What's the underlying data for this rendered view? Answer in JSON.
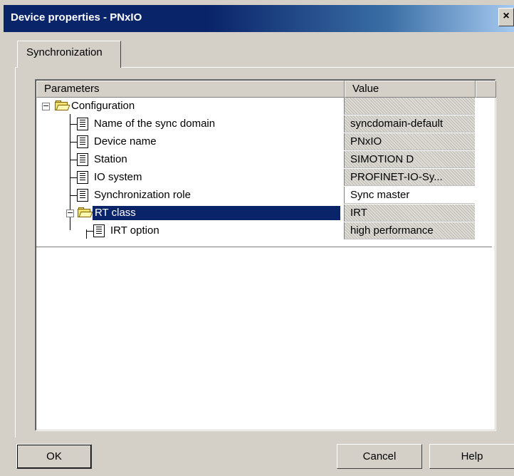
{
  "window": {
    "title": "Device properties - PNxIO",
    "close_glyph": "×"
  },
  "tabs": [
    {
      "label": "Synchronization"
    }
  ],
  "table": {
    "headers": {
      "parameters": "Parameters",
      "value": "Value"
    },
    "rows": [
      {
        "label": "Configuration",
        "value": "",
        "kind": "folder"
      },
      {
        "label": "Name of the sync domain",
        "value": "syncdomain-default",
        "kind": "doc"
      },
      {
        "label": "Device name",
        "value": "PNxIO",
        "kind": "doc"
      },
      {
        "label": "Station",
        "value": "SIMOTION D",
        "kind": "doc"
      },
      {
        "label": "IO system",
        "value": "PROFINET-IO-Sy...",
        "kind": "doc"
      },
      {
        "label": "Synchronization role",
        "value": "Sync master",
        "kind": "doc"
      },
      {
        "label": "RT class",
        "value": "IRT",
        "kind": "folder",
        "selected": true
      },
      {
        "label": "IRT option",
        "value": "high performance",
        "kind": "doc"
      }
    ]
  },
  "buttons": {
    "ok": "OK",
    "cancel": "Cancel",
    "help": "Help"
  },
  "icons": {
    "expander_collapse": "−",
    "expander_expand": "−"
  },
  "colors": {
    "title_bar": "#0a246a",
    "selection": "#0a246a"
  }
}
